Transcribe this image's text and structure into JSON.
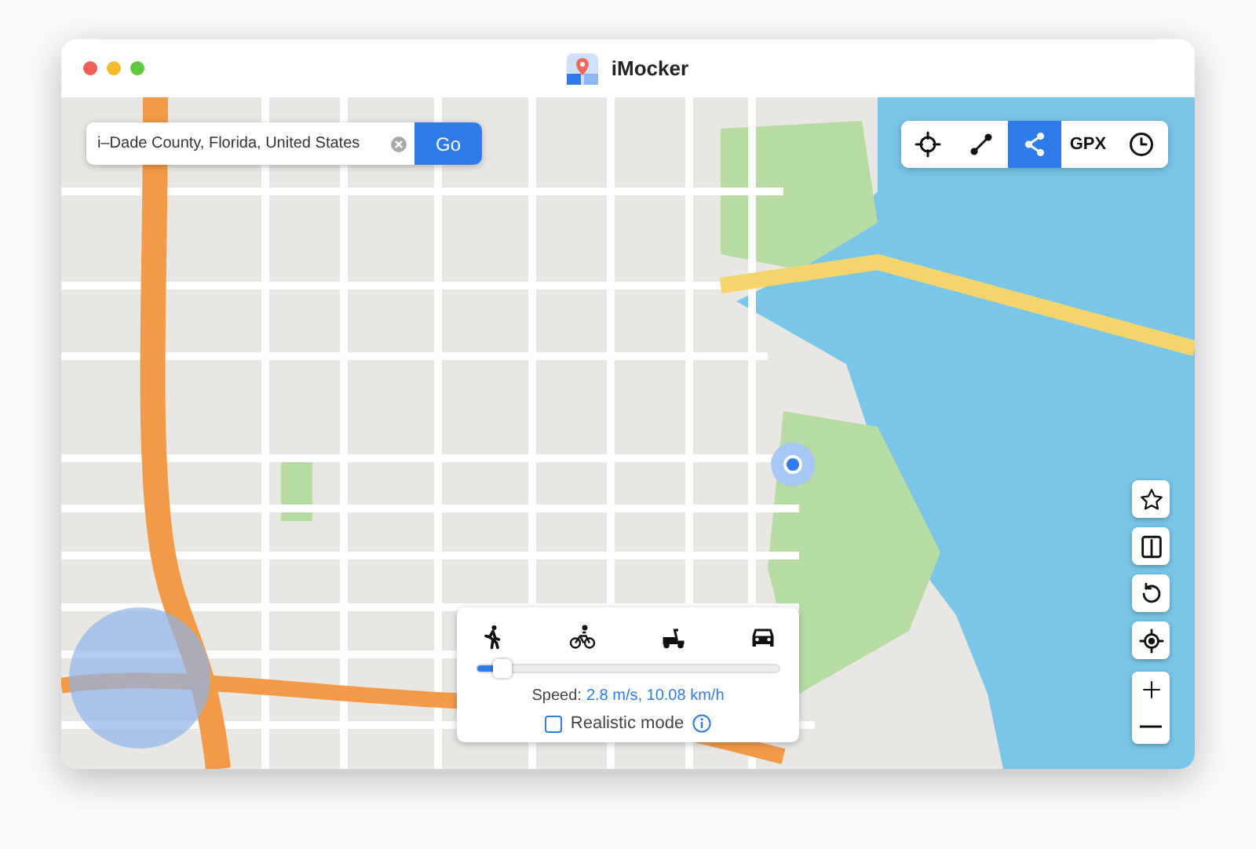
{
  "window": {
    "title": "iMocker"
  },
  "search": {
    "value": "i–Dade County, Florida, United States",
    "button": "Go"
  },
  "toolbar": [
    {
      "selected": false
    },
    {
      "selected": false
    },
    {
      "selected": true
    },
    {
      "label": "GPX",
      "selected": false
    },
    {
      "selected": false
    }
  ],
  "speed_panel": {
    "level": 0.06,
    "speed_label": "Speed:",
    "speed_value": "2.8 m/s, 10.08 km/h",
    "realistic": {
      "label": "Realistic mode",
      "checked": false
    }
  }
}
